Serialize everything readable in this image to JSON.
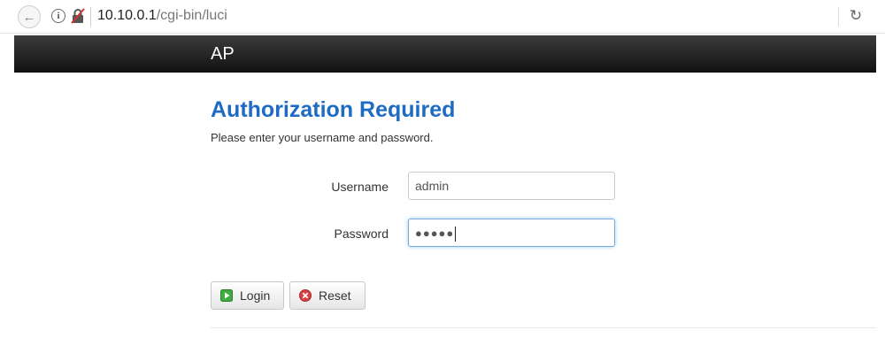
{
  "browser": {
    "url_host": "10.10.0.1",
    "url_path": "/cgi-bin/luci",
    "back_icon": "arrow-left-icon",
    "info_icon": "info-icon",
    "security_icon": "insecure-lock-icon",
    "reload_icon": "reload-icon"
  },
  "header": {
    "brand": "AP"
  },
  "login": {
    "title": "Authorization Required",
    "description": "Please enter your username and password.",
    "username_label": "Username",
    "username_value": "admin",
    "password_label": "Password",
    "password_mask": "●●●●●",
    "login_button": "Login",
    "reset_button": "Reset"
  },
  "colors": {
    "title": "#1e6bc6",
    "header_bg": "#1f1f1f",
    "login_icon": "#2e9b2e",
    "reset_icon": "#d43a3a"
  }
}
